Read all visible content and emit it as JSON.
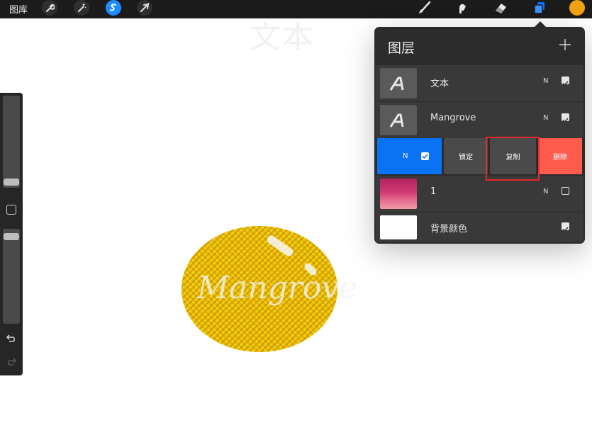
{
  "topbar": {
    "gallery_label": "图库",
    "left_icons": [
      "wrench-icon",
      "magic-wand-icon",
      "selection-icon",
      "transform-arrow-icon"
    ],
    "right_icons": [
      "brush-icon",
      "smudge-icon",
      "eraser-icon",
      "layers-icon"
    ],
    "current_color": "#f2a20f"
  },
  "canvas": {
    "ghost_text": "文本",
    "artwork_text": "Mangrove"
  },
  "layers_panel": {
    "title": "图层",
    "layers": [
      {
        "name": "文本",
        "blend": "N",
        "visible": true,
        "thumb": "text-layer-icon"
      },
      {
        "name": "Mangrove",
        "blend": "N",
        "visible": true,
        "thumb": "text-layer-icon"
      },
      {
        "name": "1",
        "blend": "N",
        "visible": false,
        "thumb": "gradient-thumbnail"
      },
      {
        "name": "背景颜色",
        "blend": "",
        "visible": true,
        "thumb": "white-swatch"
      }
    ],
    "swiped_row": {
      "blend": "N",
      "actions": [
        {
          "label": "锁定",
          "color": "#4a4a4a"
        },
        {
          "label": "复制",
          "color": "#4a4a4a"
        },
        {
          "label": "删除",
          "color": "#ff5c4e"
        }
      ],
      "selected_color": "#0a73f5"
    }
  }
}
